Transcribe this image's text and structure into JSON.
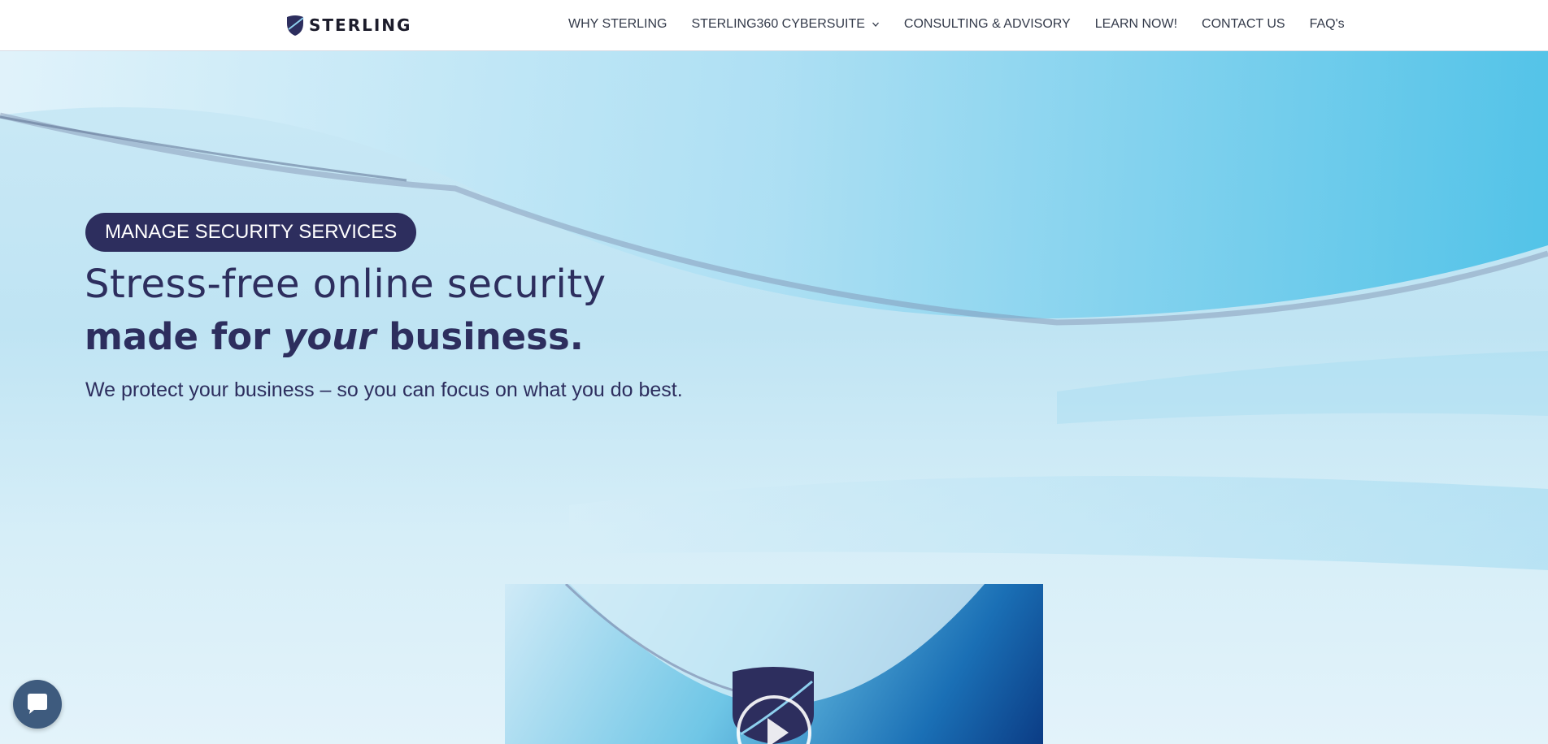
{
  "brand": {
    "logo_text": "STERLING"
  },
  "nav": {
    "items": [
      {
        "label": "WHY STERLING"
      },
      {
        "label": "STERLING360 CYBERSUITE"
      },
      {
        "label": "CONSULTING & ADVISORY"
      },
      {
        "label": "LEARN NOW!"
      },
      {
        "label": "CONTACT US"
      },
      {
        "label": "FAQ's"
      }
    ]
  },
  "hero": {
    "badge": "MANAGE SECURITY SERVICES",
    "headline_line1": "Stress-free online security",
    "headline_line2_pre": "made for ",
    "headline_line2_em": "your",
    "headline_line2_post": " business.",
    "subtitle": "We protect your business – so you can focus on what you do best."
  },
  "icons": {
    "logo": "shield-logo-icon",
    "dropdown": "chevron-down-icon",
    "video": "play-icon",
    "chat": "chat-bubble-icon"
  },
  "colors": {
    "brand_navy": "#2d2e5e",
    "hero_light_blue": "#bfe4f3",
    "chat_button": "#3e5b7e"
  }
}
